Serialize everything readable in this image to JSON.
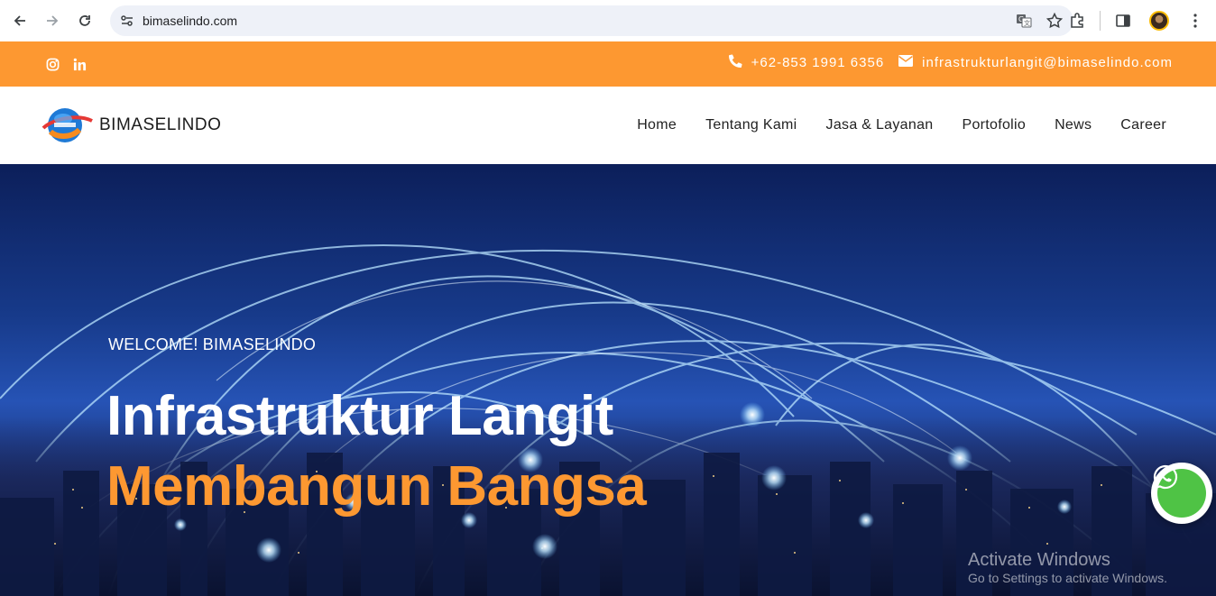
{
  "browser": {
    "url": "bimaselindo.com",
    "icons": [
      "back-arrow-icon",
      "forward-arrow-icon",
      "reload-icon",
      "site-settings-icon",
      "translate-icon",
      "bookmark-star-icon",
      "extensions-icon",
      "side-panel-icon",
      "profile-avatar",
      "more-menu-icon"
    ]
  },
  "topbar": {
    "color": "#fd9831",
    "social": [
      "instagram-icon",
      "linkedin-icon"
    ],
    "phone": "+62-853 1991 6356",
    "email": "infrastrukturlangit@bimaselindo.com"
  },
  "header": {
    "logo_text": "BIMASELINDO",
    "menu": [
      "Home",
      "Tentang Kami",
      "Jasa & Layanan",
      "Portofolio",
      "News",
      "Career"
    ]
  },
  "hero": {
    "welcome": "WELCOME! BIMASELINDO",
    "title_line1": "Infrastruktur Langit",
    "title_line2": "Membangun Bangsa",
    "accent_color": "#fd9831",
    "whatsapp_icon": "whatsapp-icon"
  },
  "watermark": {
    "line1": "Activate Windows",
    "line2": "Go to Settings to activate Windows."
  }
}
